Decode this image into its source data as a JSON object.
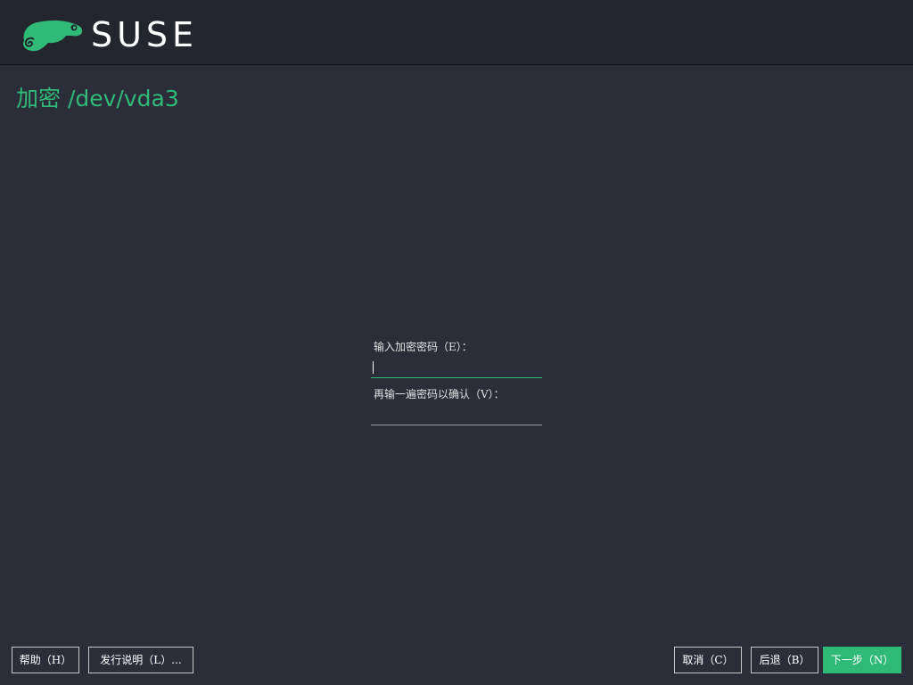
{
  "header": {
    "brand": "SUSE",
    "brand_color": "#30ba78"
  },
  "page": {
    "title": "加密 /dev/vda3"
  },
  "form": {
    "password_label": "输入加密密码（E）：",
    "password_value": "",
    "confirm_label": "再输一遍密码以确认（V）：",
    "confirm_value": ""
  },
  "footer": {
    "help_label": "帮助（H）",
    "notes_label": "发行说明（L）...",
    "cancel_label": "取消（C）",
    "back_label": "后退（B）",
    "next_label": "下一步（N）"
  },
  "icons": {
    "logo": "suse-chameleon-icon"
  }
}
